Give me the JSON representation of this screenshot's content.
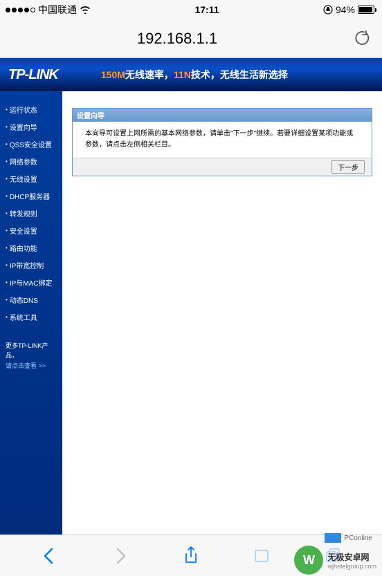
{
  "statusbar": {
    "carrier": "中国联通",
    "time": "17:11",
    "battery": "94%"
  },
  "browser": {
    "url": "192.168.1.1"
  },
  "router": {
    "logo": "TP-LINK",
    "banner_orange": "150M",
    "banner_white1": "无线速率，",
    "banner_white2": "11N",
    "banner_white3": "技术，无线生活新选择",
    "menu": [
      "运行状态",
      "设置向导",
      "QSS安全设置",
      "网络参数",
      "无线设置",
      "DHCP服务器",
      "转发规则",
      "安全设置",
      "路由功能",
      "IP带宽控制",
      "IP与MAC绑定",
      "动态DNS",
      "系统工具"
    ],
    "menu_footer1": "更多TP-LINK产品，",
    "menu_footer2": "请点击查看 >>",
    "wizard": {
      "title": "设置向导",
      "body": "本向导可设置上网所需的基本网络参数，请单击\"下一步\"继续。若要详细设置某项功能或参数，请点击左侧相关栏目。",
      "next_button": "下一步"
    }
  },
  "watermark": {
    "pconline": "PConline",
    "logo_text": "W",
    "main": "无极安卓网",
    "sub": "wjhotelgroup.com"
  }
}
